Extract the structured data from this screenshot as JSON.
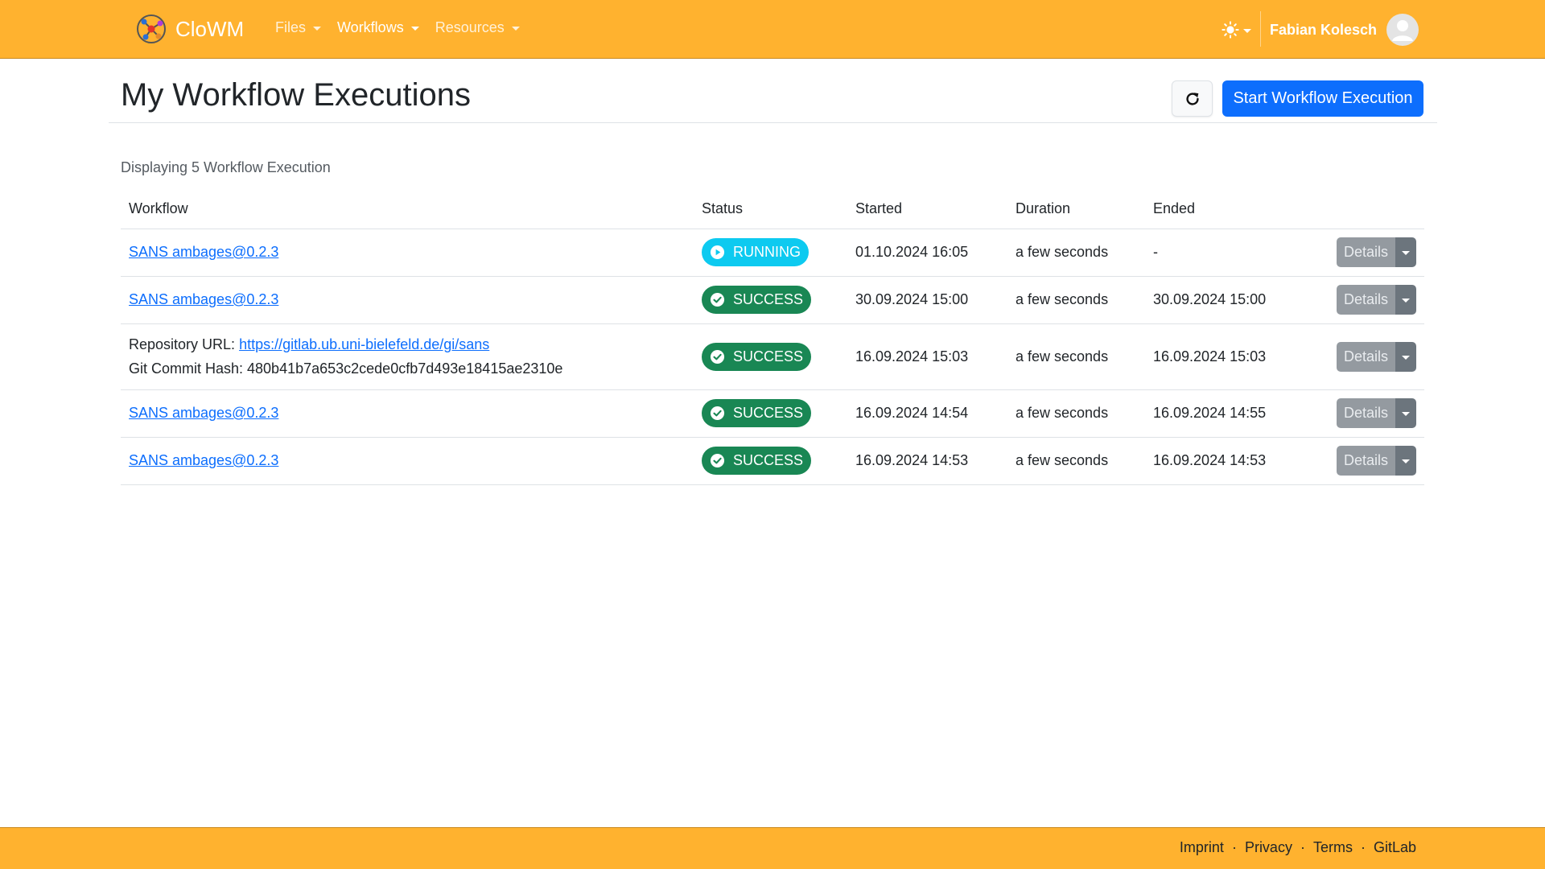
{
  "navbar": {
    "brand": "CloWM",
    "menu": [
      {
        "label": "Files"
      },
      {
        "label": "Workflows"
      },
      {
        "label": "Resources"
      }
    ],
    "theme_icon": "sun-icon",
    "user_name": "Fabian Kolesch",
    "accent_color": "#FFB22F"
  },
  "header": {
    "title": "My Workflow Executions",
    "refresh_icon": "refresh-icon",
    "start_button": "Start Workflow Execution"
  },
  "summary": "Displaying 5 Workflow Execution",
  "table": {
    "columns": [
      "Workflow",
      "Status",
      "Started",
      "Duration",
      "Ended"
    ],
    "rows": [
      {
        "workflow": "SANS ambages@0.2.3",
        "status": "RUNNING",
        "started": "01.10.2024 16:05",
        "duration": "a few seconds",
        "ended": "-",
        "details": "Details"
      },
      {
        "workflow": "SANS ambages@0.2.3",
        "status": "SUCCESS",
        "started": "30.09.2024 15:00",
        "duration": "a few seconds",
        "ended": "30.09.2024 15:00",
        "details": "Details"
      },
      {
        "repo_label": "Repository URL:",
        "repo_url": "https://gitlab.ub.uni-bielefeld.de/gi/sans",
        "commit_line": "Git Commit Hash: 480b41b7a653c2cede0cfb7d493e18415ae2310e",
        "status": "SUCCESS",
        "started": "16.09.2024 15:03",
        "duration": "a few seconds",
        "ended": "16.09.2024 15:03",
        "details": "Details"
      },
      {
        "workflow": "SANS ambages@0.2.3",
        "status": "SUCCESS",
        "started": "16.09.2024 14:54",
        "duration": "a few seconds",
        "ended": "16.09.2024 14:55",
        "details": "Details"
      },
      {
        "workflow": "SANS ambages@0.2.3",
        "status": "SUCCESS",
        "started": "16.09.2024 14:53",
        "duration": "a few seconds",
        "ended": "16.09.2024 14:53",
        "details": "Details"
      }
    ]
  },
  "status_colors": {
    "running": "#0dcaf0",
    "success": "#198754"
  },
  "footer": {
    "links": [
      "Imprint",
      "Privacy",
      "Terms",
      "GitLab"
    ],
    "separator": "·"
  }
}
